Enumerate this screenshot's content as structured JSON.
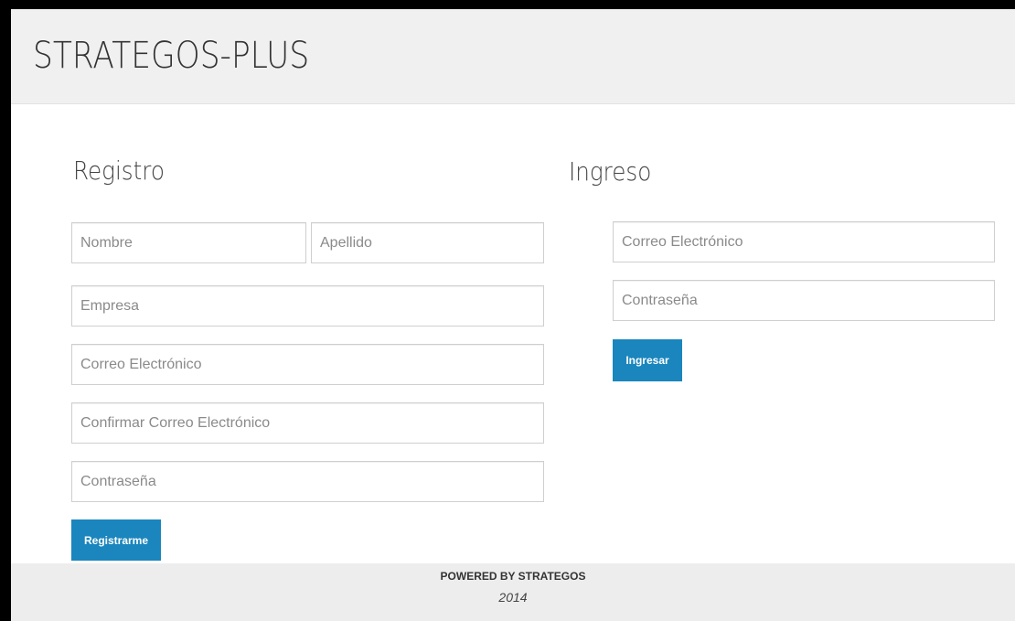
{
  "header": {
    "brand": "STRATEGOS-PLUS"
  },
  "registro": {
    "title": "Registro",
    "nombre_placeholder": "Nombre",
    "apellido_placeholder": "Apellido",
    "empresa_placeholder": "Empresa",
    "correo_placeholder": "Correo Electrónico",
    "confirmar_placeholder": "Confirmar Correo Electrónico",
    "contrasena_placeholder": "Contraseña",
    "submit_label": "Registrarme"
  },
  "ingreso": {
    "title": "Ingreso",
    "correo_placeholder": "Correo Electrónico",
    "contrasena_placeholder": "Contraseña",
    "submit_label": "Ingresar"
  },
  "footer": {
    "powered": "POWERED BY STRATEGOS",
    "year": "2014"
  },
  "colors": {
    "accent": "#1a86bd",
    "header_bg": "#f0f0f0",
    "footer_bg": "#ededed"
  }
}
